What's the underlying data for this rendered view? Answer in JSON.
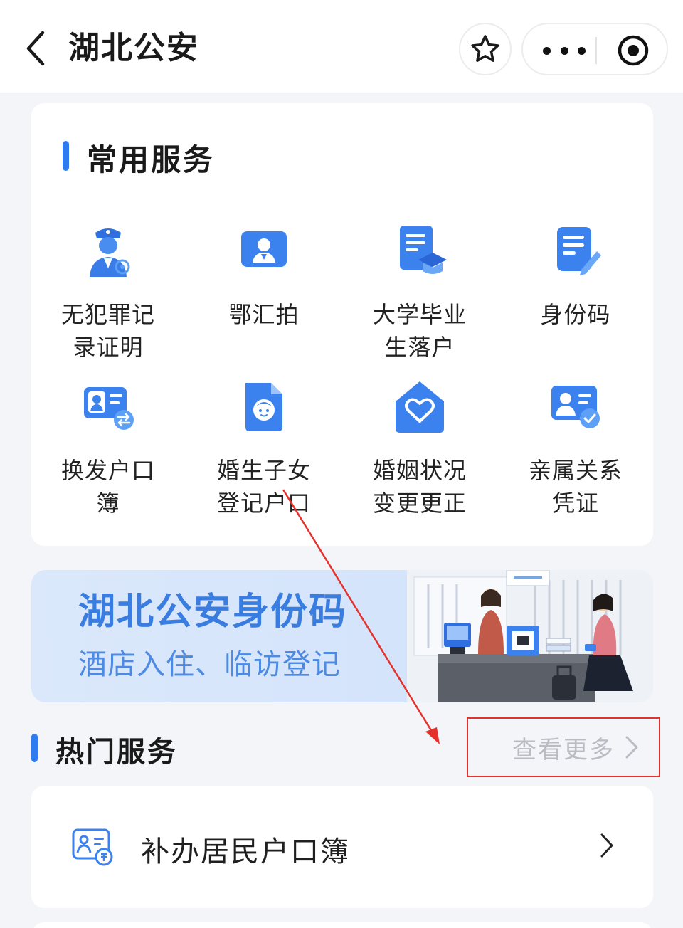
{
  "nav": {
    "title": "湖北公安"
  },
  "common_services": {
    "title": "常用服务",
    "items": [
      {
        "label_line1": "无犯罪记",
        "label_line2": "录证明",
        "icon": "police-officer-icon"
      },
      {
        "label_line1": "鄂汇拍",
        "label_line2": "",
        "icon": "id-photo-icon"
      },
      {
        "label_line1": "大学毕业",
        "label_line2": "生落户",
        "icon": "graduation-document-icon"
      },
      {
        "label_line1": "身份码",
        "label_line2": "",
        "icon": "edit-document-icon"
      },
      {
        "label_line1": "换发户口",
        "label_line2": "簿",
        "icon": "id-card-exchange-icon"
      },
      {
        "label_line1": "婚生子女",
        "label_line2": "登记户口",
        "icon": "baby-document-icon"
      },
      {
        "label_line1": "婚姻状况",
        "label_line2": "变更更正",
        "icon": "heart-house-icon"
      },
      {
        "label_line1": "亲属关系",
        "label_line2": "凭证",
        "icon": "relatives-verified-icon"
      }
    ]
  },
  "banner": {
    "title": "湖北公安身份码",
    "subtitle": "酒店入住、临访登记"
  },
  "hot_services": {
    "title": "热门服务",
    "more_label": "查看更多",
    "items": [
      {
        "label": "补办居民户口簿",
        "icon": "household-register-icon"
      }
    ]
  },
  "colors": {
    "accent": "#2f7bf0",
    "annotation": "#e5312c"
  }
}
